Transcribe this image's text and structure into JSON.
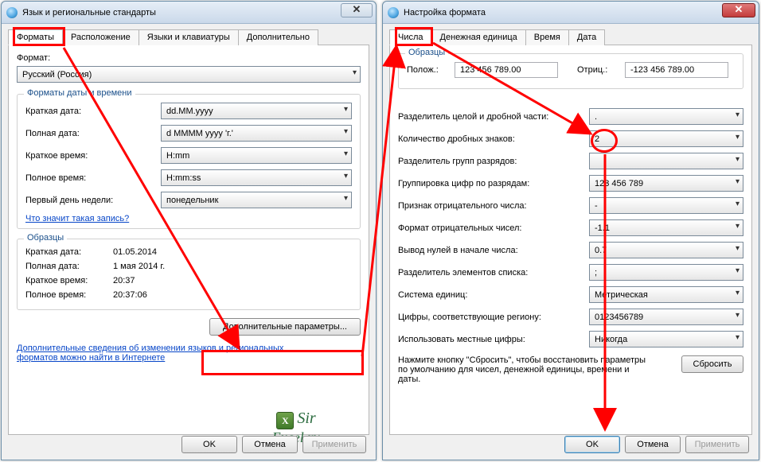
{
  "left": {
    "title": "Язык и региональные стандарты",
    "tabs": {
      "formats": "Форматы",
      "location": "Расположение",
      "langs": "Языки и клавиатуры",
      "advanced": "Дополнительно"
    },
    "format_label": "Формат:",
    "format_value": "Русский (Россия)",
    "group_dt": "Форматы даты и времени",
    "short_date_label": "Краткая дата:",
    "short_date_value": "dd.MM.yyyy",
    "long_date_label": "Полная дата:",
    "long_date_value": "d MMMM yyyy 'г.'",
    "short_time_label": "Краткое время:",
    "short_time_value": "H:mm",
    "long_time_label": "Полное время:",
    "long_time_value": "H:mm:ss",
    "first_day_label": "Первый день недели:",
    "first_day_value": "понедельник",
    "what_link": "Что значит такая запись?",
    "samples_title": "Образцы",
    "sample_short_date_label": "Краткая дата:",
    "sample_short_date_value": "01.05.2014",
    "sample_long_date_label": "Полная дата:",
    "sample_long_date_value": "1 мая 2014 г.",
    "sample_short_time_label": "Краткое время:",
    "sample_short_time_value": "20:37",
    "sample_long_time_label": "Полное время:",
    "sample_long_time_value": "20:37:06",
    "btn_more": "Дополнительные параметры...",
    "more_info_link": "Дополнительные сведения об изменении языков и региональных форматов можно найти в Интернете",
    "ok": "OK",
    "cancel": "Отмена",
    "apply": "Применить"
  },
  "right": {
    "title": "Настройка формата",
    "tabs": {
      "numbers": "Числа",
      "currency": "Денежная единица",
      "time": "Время",
      "date": "Дата"
    },
    "samples_title": "Образцы",
    "pos_label": "Полож.:",
    "pos_value": "123 456 789.00",
    "neg_label": "Отриц.:",
    "neg_value": "-123 456 789.00",
    "decimal_sep_label": "Разделитель целой и дробной части:",
    "decimal_sep_value": ".",
    "decimal_digits_label": "Количество дробных знаков:",
    "decimal_digits_value": "2",
    "group_sep_label": "Разделитель групп разрядов:",
    "group_sep_value": " ",
    "grouping_label": "Группировка цифр по разрядам:",
    "grouping_value": "123 456 789",
    "neg_sign_label": "Признак отрицательного числа:",
    "neg_sign_value": "-",
    "neg_format_label": "Формат отрицательных чисел:",
    "neg_format_value": "-1.1",
    "leading_zero_label": "Вывод нулей в начале числа:",
    "leading_zero_value": "0.7",
    "list_sep_label": "Разделитель элементов списка:",
    "list_sep_value": ";",
    "measure_label": "Система единиц:",
    "measure_value": "Метрическая",
    "digits_label": "Цифры, соответствующие региону:",
    "digits_value": "0123456789",
    "native_digits_label": "Использовать местные цифры:",
    "native_digits_value": "Никогда",
    "reset_note": "Нажмите кнопку \"Сбросить\", чтобы восстановить параметры по умолчанию для чисел, денежной единицы, времени и даты.",
    "reset_btn": "Сбросить",
    "ok": "OK",
    "cancel": "Отмена",
    "apply": "Применить"
  },
  "watermark": {
    "name": "Sir",
    "site": "Excel.ru"
  }
}
